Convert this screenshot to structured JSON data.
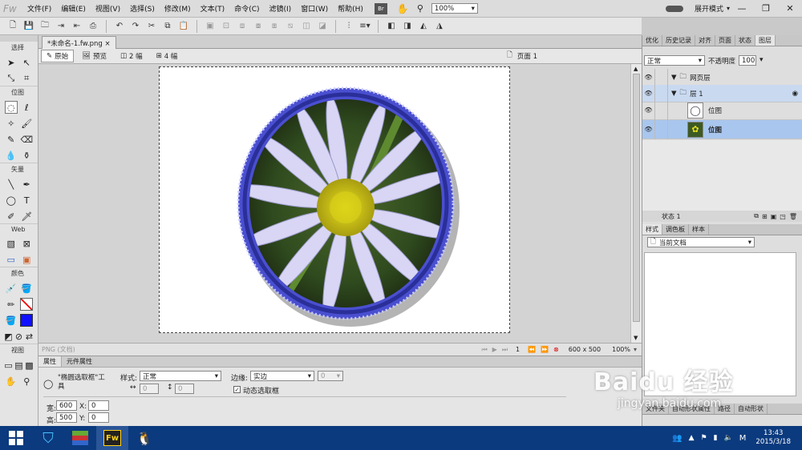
{
  "app": {
    "logo": "Fw",
    "mode": "展开模式",
    "zoom": "100%"
  },
  "menu": [
    "文件(F)",
    "编辑(E)",
    "视图(V)",
    "选择(S)",
    "修改(M)",
    "文本(T)",
    "命令(C)",
    "滤镜(I)",
    "窗口(W)",
    "帮助(H)"
  ],
  "menu_extra": {
    "br": "Br"
  },
  "doc": {
    "tab": "*未命名-1.fw.png",
    "close": "×",
    "page": "页面 1"
  },
  "view_buttons": [
    "原始",
    "预览",
    "2 幅",
    "4 幅"
  ],
  "tools": {
    "sections": [
      "选择",
      "位图",
      "矢量",
      "Web",
      "颜色",
      "视图"
    ]
  },
  "status": {
    "format": "PNG (文档)",
    "frame": "1",
    "size": "600 x 500",
    "zoom": "100%"
  },
  "props": {
    "tabs": [
      "属性",
      "元件属性"
    ],
    "tool_name": "\"椭圆选取框\"工具",
    "style_label": "样式:",
    "style_value": "正常",
    "edge_label": "边缘:",
    "edge_value": "实边",
    "edge_amount": "0",
    "dyn_label": "动态选取框",
    "w_label": "宽:",
    "w_value": "600",
    "h_label": "高:",
    "h_value": "500",
    "x_label": "X:",
    "x_value": "0",
    "y_label": "Y:",
    "y_value": "0",
    "fixed_w": "0",
    "fixed_h": "0"
  },
  "rpanel": {
    "tabs": [
      "优化",
      "历史记录",
      "对齐",
      "页面",
      "状态",
      "图层"
    ],
    "blend": "正常",
    "opacity_label": "不透明度",
    "opacity": "100",
    "layers": [
      {
        "name": "网页层",
        "indent": 0
      },
      {
        "name": "层 1",
        "indent": 1
      },
      {
        "name": "位图",
        "indent": 2
      },
      {
        "name": "位图",
        "indent": 2
      }
    ],
    "state": "状态 1",
    "tabs2": [
      "样式",
      "调色板",
      "样本"
    ],
    "doc_select": "当前文档",
    "bottom_tabs": [
      "文件夹",
      "自动形状属性",
      "路径",
      "自动形状"
    ]
  },
  "taskbar": {
    "time": "13:43",
    "date": "2015/3/18",
    "fw_label": "Fw"
  },
  "watermark": {
    "brand": "Baidu 经验",
    "url": "jingyan.baidu.com"
  },
  "colors": {
    "accent": "#0b3a7e",
    "selection": "#a9c6ee",
    "frame": "#4a4fd0"
  }
}
